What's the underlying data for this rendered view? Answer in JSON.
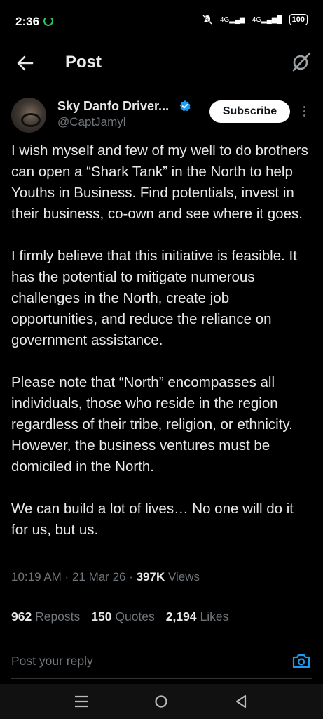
{
  "status": {
    "time": "2:36",
    "net1": "4G",
    "net2": "4G",
    "battery": "100"
  },
  "header": {
    "title": "Post"
  },
  "author": {
    "name": "Sky Danfo Driver...",
    "handle": "@CaptJamyl",
    "subscribe_label": "Subscribe"
  },
  "post": {
    "paragraphs": [
      "I wish myself and few of my well to do brothers can open a “Shark Tank” in the North to help Youths in Business. Find potentials, invest in their business, co-own and see where it goes.",
      "I firmly believe that this initiative is feasible. It has the potential to mitigate numerous challenges in the North, create job opportunities, and reduce the reliance on government assistance.",
      "Please note that “North” encompasses all individuals, those who reside in the region regardless of their tribe, religion, or ethnicity. However, the business ventures must be domiciled in the North.",
      "We can build a lot of lives… No one will do it for us, but us."
    ]
  },
  "meta": {
    "time": "10:19 AM",
    "date": "21 Mar 26",
    "views_count": "397K",
    "views_label": "Views"
  },
  "stats": {
    "reposts_count": "962",
    "reposts_label": "Reposts",
    "quotes_count": "150",
    "quotes_label": "Quotes",
    "likes_count": "2,194",
    "likes_label": "Likes"
  },
  "reply": {
    "placeholder": "Post your reply"
  },
  "colors": {
    "background": "#000000",
    "text": "#e7e9ea",
    "muted": "#71767b",
    "accent": "#1d9bf0"
  },
  "icons": [
    "back-arrow-icon",
    "grok-icon",
    "verified-badge-icon",
    "more-icon",
    "camera-icon",
    "menu-icon",
    "home-icon",
    "back-triangle-icon"
  ]
}
